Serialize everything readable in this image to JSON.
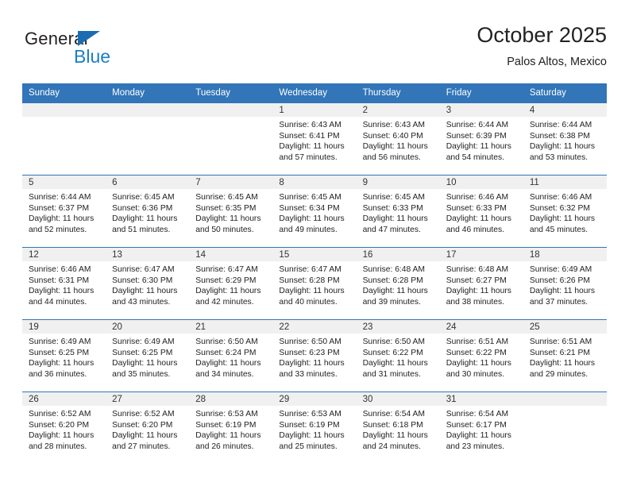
{
  "brand": {
    "name_primary": "General",
    "name_secondary": "Blue",
    "triangle_color": "#1b6cb0",
    "blue_color": "#1b7ec6"
  },
  "header": {
    "title": "October 2025",
    "subtitle": "Palos Altos, Mexico"
  },
  "theme": {
    "header_bar_color": "#3275b8",
    "daynum_band_color": "#f0f0f0",
    "grid_line_color": "#3275b8",
    "text_color": "#222222"
  },
  "weekday_headers": [
    "Sunday",
    "Monday",
    "Tuesday",
    "Wednesday",
    "Thursday",
    "Friday",
    "Saturday"
  ],
  "weeks": [
    [
      {
        "day": "",
        "sunrise": "",
        "sunset": "",
        "daylight_line1": "",
        "daylight_line2": ""
      },
      {
        "day": "",
        "sunrise": "",
        "sunset": "",
        "daylight_line1": "",
        "daylight_line2": ""
      },
      {
        "day": "",
        "sunrise": "",
        "sunset": "",
        "daylight_line1": "",
        "daylight_line2": ""
      },
      {
        "day": "1",
        "sunrise": "Sunrise: 6:43 AM",
        "sunset": "Sunset: 6:41 PM",
        "daylight_line1": "Daylight: 11 hours",
        "daylight_line2": "and 57 minutes."
      },
      {
        "day": "2",
        "sunrise": "Sunrise: 6:43 AM",
        "sunset": "Sunset: 6:40 PM",
        "daylight_line1": "Daylight: 11 hours",
        "daylight_line2": "and 56 minutes."
      },
      {
        "day": "3",
        "sunrise": "Sunrise: 6:44 AM",
        "sunset": "Sunset: 6:39 PM",
        "daylight_line1": "Daylight: 11 hours",
        "daylight_line2": "and 54 minutes."
      },
      {
        "day": "4",
        "sunrise": "Sunrise: 6:44 AM",
        "sunset": "Sunset: 6:38 PM",
        "daylight_line1": "Daylight: 11 hours",
        "daylight_line2": "and 53 minutes."
      }
    ],
    [
      {
        "day": "5",
        "sunrise": "Sunrise: 6:44 AM",
        "sunset": "Sunset: 6:37 PM",
        "daylight_line1": "Daylight: 11 hours",
        "daylight_line2": "and 52 minutes."
      },
      {
        "day": "6",
        "sunrise": "Sunrise: 6:45 AM",
        "sunset": "Sunset: 6:36 PM",
        "daylight_line1": "Daylight: 11 hours",
        "daylight_line2": "and 51 minutes."
      },
      {
        "day": "7",
        "sunrise": "Sunrise: 6:45 AM",
        "sunset": "Sunset: 6:35 PM",
        "daylight_line1": "Daylight: 11 hours",
        "daylight_line2": "and 50 minutes."
      },
      {
        "day": "8",
        "sunrise": "Sunrise: 6:45 AM",
        "sunset": "Sunset: 6:34 PM",
        "daylight_line1": "Daylight: 11 hours",
        "daylight_line2": "and 49 minutes."
      },
      {
        "day": "9",
        "sunrise": "Sunrise: 6:45 AM",
        "sunset": "Sunset: 6:33 PM",
        "daylight_line1": "Daylight: 11 hours",
        "daylight_line2": "and 47 minutes."
      },
      {
        "day": "10",
        "sunrise": "Sunrise: 6:46 AM",
        "sunset": "Sunset: 6:33 PM",
        "daylight_line1": "Daylight: 11 hours",
        "daylight_line2": "and 46 minutes."
      },
      {
        "day": "11",
        "sunrise": "Sunrise: 6:46 AM",
        "sunset": "Sunset: 6:32 PM",
        "daylight_line1": "Daylight: 11 hours",
        "daylight_line2": "and 45 minutes."
      }
    ],
    [
      {
        "day": "12",
        "sunrise": "Sunrise: 6:46 AM",
        "sunset": "Sunset: 6:31 PM",
        "daylight_line1": "Daylight: 11 hours",
        "daylight_line2": "and 44 minutes."
      },
      {
        "day": "13",
        "sunrise": "Sunrise: 6:47 AM",
        "sunset": "Sunset: 6:30 PM",
        "daylight_line1": "Daylight: 11 hours",
        "daylight_line2": "and 43 minutes."
      },
      {
        "day": "14",
        "sunrise": "Sunrise: 6:47 AM",
        "sunset": "Sunset: 6:29 PM",
        "daylight_line1": "Daylight: 11 hours",
        "daylight_line2": "and 42 minutes."
      },
      {
        "day": "15",
        "sunrise": "Sunrise: 6:47 AM",
        "sunset": "Sunset: 6:28 PM",
        "daylight_line1": "Daylight: 11 hours",
        "daylight_line2": "and 40 minutes."
      },
      {
        "day": "16",
        "sunrise": "Sunrise: 6:48 AM",
        "sunset": "Sunset: 6:28 PM",
        "daylight_line1": "Daylight: 11 hours",
        "daylight_line2": "and 39 minutes."
      },
      {
        "day": "17",
        "sunrise": "Sunrise: 6:48 AM",
        "sunset": "Sunset: 6:27 PM",
        "daylight_line1": "Daylight: 11 hours",
        "daylight_line2": "and 38 minutes."
      },
      {
        "day": "18",
        "sunrise": "Sunrise: 6:49 AM",
        "sunset": "Sunset: 6:26 PM",
        "daylight_line1": "Daylight: 11 hours",
        "daylight_line2": "and 37 minutes."
      }
    ],
    [
      {
        "day": "19",
        "sunrise": "Sunrise: 6:49 AM",
        "sunset": "Sunset: 6:25 PM",
        "daylight_line1": "Daylight: 11 hours",
        "daylight_line2": "and 36 minutes."
      },
      {
        "day": "20",
        "sunrise": "Sunrise: 6:49 AM",
        "sunset": "Sunset: 6:25 PM",
        "daylight_line1": "Daylight: 11 hours",
        "daylight_line2": "and 35 minutes."
      },
      {
        "day": "21",
        "sunrise": "Sunrise: 6:50 AM",
        "sunset": "Sunset: 6:24 PM",
        "daylight_line1": "Daylight: 11 hours",
        "daylight_line2": "and 34 minutes."
      },
      {
        "day": "22",
        "sunrise": "Sunrise: 6:50 AM",
        "sunset": "Sunset: 6:23 PM",
        "daylight_line1": "Daylight: 11 hours",
        "daylight_line2": "and 33 minutes."
      },
      {
        "day": "23",
        "sunrise": "Sunrise: 6:50 AM",
        "sunset": "Sunset: 6:22 PM",
        "daylight_line1": "Daylight: 11 hours",
        "daylight_line2": "and 31 minutes."
      },
      {
        "day": "24",
        "sunrise": "Sunrise: 6:51 AM",
        "sunset": "Sunset: 6:22 PM",
        "daylight_line1": "Daylight: 11 hours",
        "daylight_line2": "and 30 minutes."
      },
      {
        "day": "25",
        "sunrise": "Sunrise: 6:51 AM",
        "sunset": "Sunset: 6:21 PM",
        "daylight_line1": "Daylight: 11 hours",
        "daylight_line2": "and 29 minutes."
      }
    ],
    [
      {
        "day": "26",
        "sunrise": "Sunrise: 6:52 AM",
        "sunset": "Sunset: 6:20 PM",
        "daylight_line1": "Daylight: 11 hours",
        "daylight_line2": "and 28 minutes."
      },
      {
        "day": "27",
        "sunrise": "Sunrise: 6:52 AM",
        "sunset": "Sunset: 6:20 PM",
        "daylight_line1": "Daylight: 11 hours",
        "daylight_line2": "and 27 minutes."
      },
      {
        "day": "28",
        "sunrise": "Sunrise: 6:53 AM",
        "sunset": "Sunset: 6:19 PM",
        "daylight_line1": "Daylight: 11 hours",
        "daylight_line2": "and 26 minutes."
      },
      {
        "day": "29",
        "sunrise": "Sunrise: 6:53 AM",
        "sunset": "Sunset: 6:19 PM",
        "daylight_line1": "Daylight: 11 hours",
        "daylight_line2": "and 25 minutes."
      },
      {
        "day": "30",
        "sunrise": "Sunrise: 6:54 AM",
        "sunset": "Sunset: 6:18 PM",
        "daylight_line1": "Daylight: 11 hours",
        "daylight_line2": "and 24 minutes."
      },
      {
        "day": "31",
        "sunrise": "Sunrise: 6:54 AM",
        "sunset": "Sunset: 6:17 PM",
        "daylight_line1": "Daylight: 11 hours",
        "daylight_line2": "and 23 minutes."
      },
      {
        "day": "",
        "sunrise": "",
        "sunset": "",
        "daylight_line1": "",
        "daylight_line2": ""
      }
    ]
  ]
}
